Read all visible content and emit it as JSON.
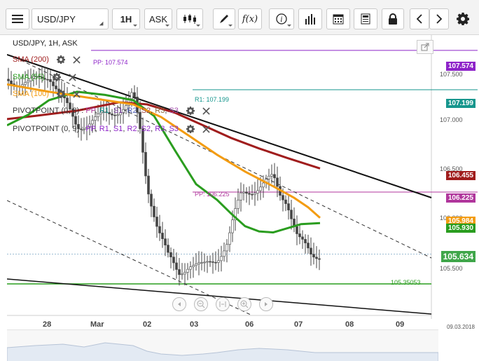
{
  "toolbar": {
    "symbol": "USD/JPY",
    "interval": "1H",
    "price_type": "ASK",
    "items": [
      "menu-icon",
      "candle-type-icon",
      "draw-pencil-icon",
      "function-icon",
      "info-icon",
      "volume-bars-icon",
      "calendar-icon",
      "report-icon",
      "lock-icon",
      "chevron-left-icon",
      "chevron-right-icon",
      "gear-icon"
    ],
    "function_label": "f(x)"
  },
  "chart_title": "USD/JPY, 1H, ASK",
  "legend": [
    {
      "label": "SMA (200)",
      "color": "#a01d1d"
    },
    {
      "label": "SMA (55)",
      "color": "#2a9d1f"
    },
    {
      "label": "SMA (100)",
      "color": "#f39c12"
    },
    {
      "label_parts": [
        {
          "text": "PIVOTPOINT (0, 8)",
          "color": "#333333"
        },
        {
          "text": " : ",
          "color": "#333333"
        },
        {
          "text": "PP",
          "color": "#b0369c"
        },
        {
          "text": ", ",
          "color": "#333333"
        },
        {
          "text": "R1",
          "color": "#16968d"
        },
        {
          "text": ", ",
          "color": "#333333"
        },
        {
          "text": "S1",
          "color": "#7a3ba1"
        },
        {
          "text": ", ",
          "color": "#333333"
        },
        {
          "text": "R2",
          "color": "#4e5fb5"
        },
        {
          "text": ", ",
          "color": "#333333"
        },
        {
          "text": "S2",
          "color": "#9a4545"
        },
        {
          "text": ", ",
          "color": "#333333"
        },
        {
          "text": "R3",
          "color": "#8c6a3a"
        },
        {
          "text": ", ",
          "color": "#333333"
        },
        {
          "text": "S3",
          "color": "#a54fb0"
        }
      ]
    },
    {
      "label_parts": [
        {
          "text": "PIVOTPOINT (0, 9)",
          "color": "#333333"
        },
        {
          "text": " : ",
          "color": "#333333"
        },
        {
          "text": "PP",
          "color": "#8e24c9"
        },
        {
          "text": ", ",
          "color": "#333333"
        },
        {
          "text": "R1",
          "color": "#8e24c9"
        },
        {
          "text": ", ",
          "color": "#333333"
        },
        {
          "text": "S1",
          "color": "#8e24c9"
        },
        {
          "text": ", ",
          "color": "#333333"
        },
        {
          "text": "R2",
          "color": "#8e24c9"
        },
        {
          "text": ", ",
          "color": "#333333"
        },
        {
          "text": "S2",
          "color": "#8e24c9"
        },
        {
          "text": ", ",
          "color": "#333333"
        },
        {
          "text": "R3",
          "color": "#8e24c9"
        },
        {
          "text": ", ",
          "color": "#333333"
        },
        {
          "text": "S3",
          "color": "#8e24c9"
        }
      ]
    }
  ],
  "line_labels": {
    "pp_top": "PP: 107.574",
    "r1": "R1: 107.199",
    "pp_mid": "PP: 106.225",
    "support": "105.35053"
  },
  "price_tags": [
    {
      "value": "107.574",
      "color": "#8e24c9"
    },
    {
      "value": "107.199",
      "color": "#16968d"
    },
    {
      "value": "106.455",
      "color": "#a01d1d"
    },
    {
      "value": "106.225",
      "color": "#b0369c"
    },
    {
      "value": "105.984",
      "color": "#f39c12"
    },
    {
      "value": "105.930",
      "color": "#2a9d1f"
    },
    {
      "value": "105.634",
      "color": "#3fa64a"
    }
  ],
  "chart_data": {
    "type": "candlestick",
    "y_axis_ticks": [
      "107.500",
      "107.000",
      "106.500",
      "106.000",
      "105.500"
    ],
    "x_axis_ticks": [
      "28",
      "Mar",
      "02",
      "03",
      "06",
      "07",
      "08",
      "09"
    ],
    "ylim": [
      105.05,
      107.72
    ],
    "series": [
      {
        "name": "SMA (200)",
        "color": "#a01d1d",
        "values": [
          [
            0,
            106.92
          ],
          [
            40,
            106.95
          ],
          [
            100,
            107.0
          ],
          [
            160,
            107.08
          ],
          [
            200,
            107.06
          ],
          [
            240,
            106.98
          ],
          [
            280,
            106.86
          ],
          [
            320,
            106.74
          ],
          [
            360,
            106.64
          ],
          [
            400,
            106.55
          ],
          [
            447,
            106.45
          ]
        ]
      },
      {
        "name": "SMA (55)",
        "color": "#2a9d1f",
        "values": [
          [
            0,
            106.86
          ],
          [
            30,
            106.96
          ],
          [
            60,
            107.1
          ],
          [
            100,
            107.18
          ],
          [
            140,
            107.15
          ],
          [
            180,
            107.1
          ],
          [
            210,
            106.95
          ],
          [
            240,
            106.62
          ],
          [
            270,
            106.3
          ],
          [
            300,
            106.15
          ],
          [
            320,
            106.02
          ],
          [
            340,
            105.9
          ],
          [
            360,
            105.85
          ],
          [
            380,
            105.84
          ],
          [
            400,
            105.88
          ],
          [
            420,
            105.92
          ],
          [
            447,
            105.93
          ]
        ]
      },
      {
        "name": "SMA (100)",
        "color": "#f39c12",
        "values": [
          [
            0,
            107.25
          ],
          [
            60,
            107.18
          ],
          [
            120,
            107.12
          ],
          [
            180,
            107.06
          ],
          [
            220,
            106.94
          ],
          [
            260,
            106.76
          ],
          [
            300,
            106.58
          ],
          [
            340,
            106.42
          ],
          [
            380,
            106.28
          ],
          [
            410,
            106.17
          ],
          [
            430,
            106.08
          ],
          [
            447,
            105.98
          ]
        ]
      },
      {
        "name": "Close",
        "color": "#333333",
        "values": [
          [
            0,
            107.3
          ],
          [
            30,
            107.25
          ],
          [
            60,
            107.35
          ],
          [
            80,
            107.1
          ],
          [
            100,
            106.85
          ],
          [
            120,
            106.9
          ],
          [
            140,
            106.95
          ],
          [
            170,
            107.05
          ],
          [
            180,
            107.15
          ],
          [
            190,
            106.8
          ],
          [
            200,
            106.3
          ],
          [
            215,
            105.9
          ],
          [
            230,
            105.6
          ],
          [
            245,
            105.45
          ],
          [
            260,
            105.55
          ],
          [
            280,
            105.5
          ],
          [
            300,
            105.6
          ],
          [
            315,
            105.75
          ],
          [
            325,
            106.0
          ],
          [
            335,
            106.2
          ],
          [
            350,
            106.25
          ],
          [
            365,
            106.3
          ],
          [
            380,
            106.35
          ],
          [
            390,
            106.2
          ],
          [
            400,
            106.15
          ],
          [
            415,
            105.8
          ],
          [
            425,
            105.7
          ],
          [
            435,
            105.6
          ],
          [
            447,
            105.63
          ]
        ]
      }
    ],
    "pivot_levels": {
      "pp_top": 107.574,
      "r1": 107.199,
      "pp_mid": 106.225
    },
    "support_level": 105.35053,
    "date_stamp": "09.03.2018"
  },
  "navigator_labels": {
    "date": "09.03.2018"
  }
}
